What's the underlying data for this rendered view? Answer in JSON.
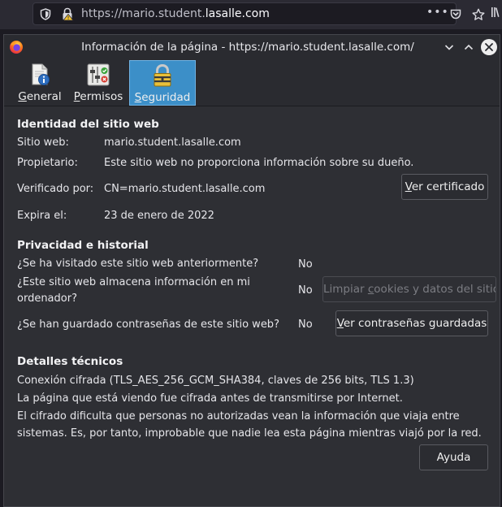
{
  "browser": {
    "url_prefix": "https://mario.student.",
    "url_domain": "lasalle.com",
    "url_menu": "•••",
    "icons": [
      "shield-icon",
      "lock-warning-icon",
      "pocket-icon",
      "bookmark-star-icon",
      "library-icon"
    ]
  },
  "dialog": {
    "title": "Información de la página - https://mario.student.lasalle.com/",
    "tabs": [
      {
        "key": "G",
        "rest": "eneral",
        "icon": "info-document-icon"
      },
      {
        "key": "P",
        "rest": "ermisos",
        "icon": "permissions-icon"
      },
      {
        "key": "S",
        "rest": "eguridad",
        "icon": "security-lock-icon",
        "selected": true
      }
    ]
  },
  "identity": {
    "heading": "Identidad del sitio web",
    "site_label": "Sitio web:",
    "site_value": "mario.student.lasalle.com",
    "owner_label": "Propietario:",
    "owner_value": "Este sitio web no proporciona información sobre su dueño.",
    "verified_label": "Verificado por:",
    "verified_value": "CN=mario.student.lasalle.com",
    "cert_button_key": "V",
    "cert_button_rest": "er certificado",
    "expires_label": "Expira el:",
    "expires_value": "23 de enero de 2022"
  },
  "privacy": {
    "heading": "Privacidad e historial",
    "visited_q": "¿Se ha visitado este sitio web anteriormente?",
    "visited_a": "No",
    "stores_q_line1": "¿Este sitio web almacena información en mi",
    "stores_q_line2": "ordenador?",
    "stores_a": "No",
    "clear_button_a": "Limpiar ",
    "clear_button_key": "c",
    "clear_button_b": "ookies y datos del sitio",
    "passwords_q": "¿Se han guardado contraseñas de este sitio web?",
    "passwords_a": "No",
    "passwords_button_key": "V",
    "passwords_button_rest": "er contraseñas guardadas"
  },
  "technical": {
    "heading": "Detalles técnicos",
    "connection": "Conexión cifrada (TLS_AES_256_GCM_SHA384, claves de 256 bits, TLS 1.3)",
    "encrypted_note": "La página que está viendo fue cifrada antes de transmitirse por Internet.",
    "explanation": "El cifrado dificulta que personas no autorizadas vean la información que viaja entre sistemas. Es, por tanto, improbable que nadie lea esta página mientras viajó por la red.",
    "help_button": "Ayuda"
  },
  "colors": {
    "selected_tab": "#3c8fc8",
    "dialog_bg": "#2e2f34",
    "warning_lock": "#f4c430"
  }
}
